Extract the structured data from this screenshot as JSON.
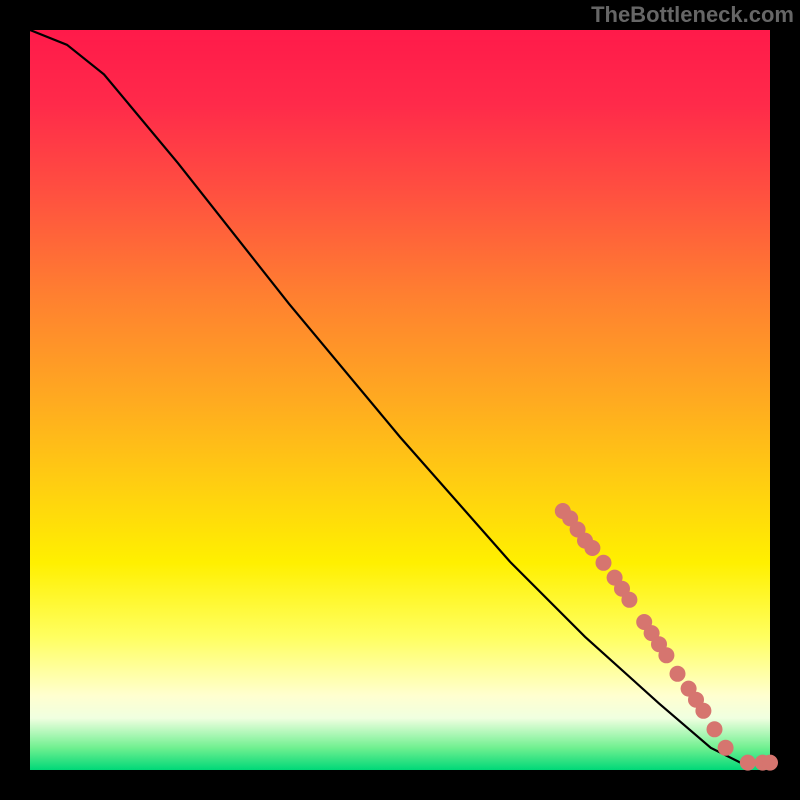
{
  "watermark": "TheBottleneck.com",
  "colors": {
    "gradient_top": "#ff1a4a",
    "gradient_mid": "#ffd010",
    "gradient_bottom": "#00d878",
    "curve": "#000000",
    "point_fill": "#d6756f"
  },
  "chart_data": {
    "type": "line",
    "title": "",
    "xlabel": "",
    "ylabel": "",
    "xrange": [
      0,
      100
    ],
    "yrange": [
      0,
      100
    ],
    "grid": false,
    "legend": false,
    "curve_points": [
      {
        "x": 0,
        "y": 100
      },
      {
        "x": 5,
        "y": 98
      },
      {
        "x": 10,
        "y": 94
      },
      {
        "x": 20,
        "y": 82
      },
      {
        "x": 35,
        "y": 63
      },
      {
        "x": 50,
        "y": 45
      },
      {
        "x": 65,
        "y": 28
      },
      {
        "x": 75,
        "y": 18
      },
      {
        "x": 85,
        "y": 9
      },
      {
        "x": 92,
        "y": 3
      },
      {
        "x": 96,
        "y": 1
      },
      {
        "x": 100,
        "y": 1
      }
    ],
    "series": [
      {
        "name": "markers",
        "points": [
          {
            "x": 72,
            "y": 35
          },
          {
            "x": 73,
            "y": 34
          },
          {
            "x": 74,
            "y": 32.5
          },
          {
            "x": 75,
            "y": 31
          },
          {
            "x": 76,
            "y": 30
          },
          {
            "x": 77.5,
            "y": 28
          },
          {
            "x": 79,
            "y": 26
          },
          {
            "x": 80,
            "y": 24.5
          },
          {
            "x": 81,
            "y": 23
          },
          {
            "x": 83,
            "y": 20
          },
          {
            "x": 84,
            "y": 18.5
          },
          {
            "x": 85,
            "y": 17
          },
          {
            "x": 86,
            "y": 15.5
          },
          {
            "x": 87.5,
            "y": 13
          },
          {
            "x": 89,
            "y": 11
          },
          {
            "x": 90,
            "y": 9.5
          },
          {
            "x": 91,
            "y": 8
          },
          {
            "x": 92.5,
            "y": 5.5
          },
          {
            "x": 94,
            "y": 3
          },
          {
            "x": 97,
            "y": 1
          },
          {
            "x": 99,
            "y": 1
          },
          {
            "x": 100,
            "y": 1
          }
        ]
      }
    ]
  }
}
